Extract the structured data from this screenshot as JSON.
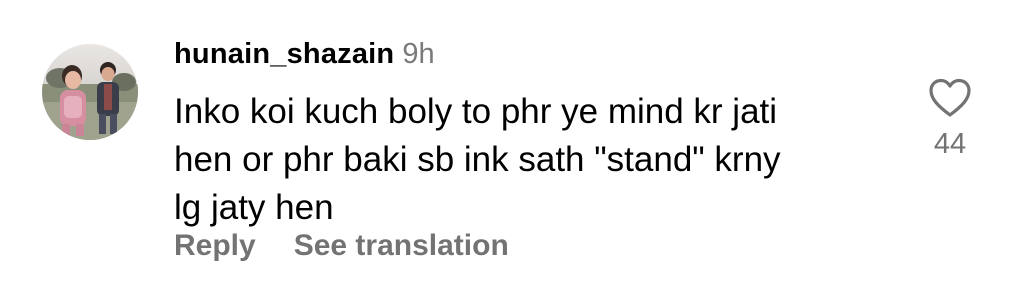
{
  "comment": {
    "username": "hunain_shazain",
    "timestamp": "9h",
    "text_lines": [
      "Inko koi kuch boly to phr ye mind kr jati",
      "hen or phr baki sb ink sath \"stand\" krny",
      "lg jaty hen"
    ],
    "reply_label": "Reply",
    "translate_label": "See translation",
    "like_count": "44",
    "like_icon": "heart-outline-icon",
    "avatar_image": "profile-photo"
  },
  "colors": {
    "text": "#000000",
    "secondary": "#737373",
    "timestamp": "#7a7a7a",
    "background": "#ffffff"
  }
}
